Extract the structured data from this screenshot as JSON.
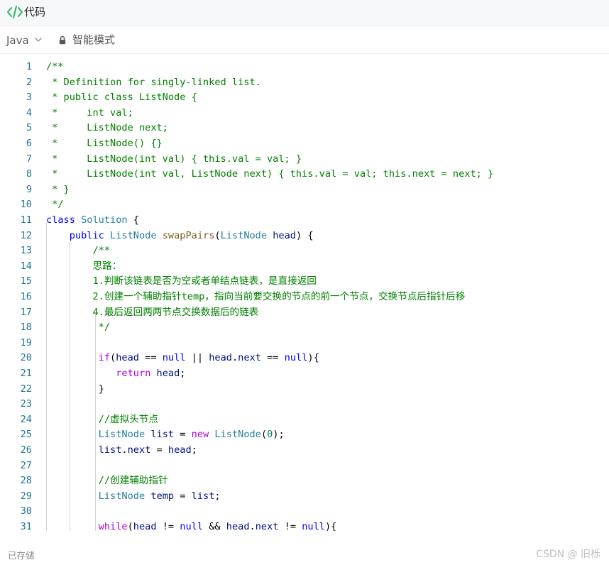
{
  "header": {
    "title": "代码",
    "icon": "code-icon",
    "accent": "#2db55d"
  },
  "toolbar": {
    "language": "Java",
    "mode": "智能模式"
  },
  "editor": {
    "lines": [
      {
        "n": "1",
        "s": [
          [
            "cm",
            "/**"
          ]
        ]
      },
      {
        "n": "2",
        "s": [
          [
            "cm",
            " * Definition for singly-linked list."
          ]
        ]
      },
      {
        "n": "3",
        "s": [
          [
            "cm",
            " * public class ListNode {"
          ]
        ]
      },
      {
        "n": "4",
        "s": [
          [
            "cm",
            " *     int val;"
          ]
        ]
      },
      {
        "n": "5",
        "s": [
          [
            "cm",
            " *     ListNode next;"
          ]
        ]
      },
      {
        "n": "6",
        "s": [
          [
            "cm",
            " *     ListNode() {}"
          ]
        ]
      },
      {
        "n": "7",
        "s": [
          [
            "cm",
            " *     ListNode(int val) { this.val = val; }"
          ]
        ]
      },
      {
        "n": "8",
        "s": [
          [
            "cm",
            " *     ListNode(int val, ListNode next) { this.val = val; this.next = next; }"
          ]
        ]
      },
      {
        "n": "9",
        "s": [
          [
            "cm",
            " * }"
          ]
        ]
      },
      {
        "n": "10",
        "s": [
          [
            "cm",
            " */"
          ]
        ]
      },
      {
        "n": "11",
        "s": [
          [
            "kw",
            "class"
          ],
          [
            "",
            " "
          ],
          [
            "ty",
            "Solution"
          ],
          [
            "",
            " {"
          ]
        ]
      },
      {
        "n": "12",
        "s": [
          [
            "",
            "    "
          ],
          [
            "kw",
            "public"
          ],
          [
            "",
            " "
          ],
          [
            "ty",
            "ListNode"
          ],
          [
            "",
            " "
          ],
          [
            "fn",
            "swapPairs"
          ],
          [
            "",
            "("
          ],
          [
            "ty",
            "ListNode"
          ],
          [
            "",
            " "
          ],
          [
            "va",
            "head"
          ],
          [
            "",
            ") {"
          ]
        ]
      },
      {
        "n": "13",
        "s": [
          [
            "cm",
            "        /**"
          ]
        ]
      },
      {
        "n": "14",
        "s": [
          [
            "cm",
            "        思路："
          ]
        ]
      },
      {
        "n": "15",
        "s": [
          [
            "cm",
            "        1.判断该链表是否为空或者单结点链表，是直接返回"
          ]
        ]
      },
      {
        "n": "16",
        "s": [
          [
            "cm",
            "        2.创建一个辅助指针temp，指向当前要交换的节点的前一个节点，交换节点后指针后移"
          ]
        ]
      },
      {
        "n": "17",
        "s": [
          [
            "cm",
            "        4.最后返回两两节点交换数据后的链表"
          ]
        ]
      },
      {
        "n": "18",
        "s": [
          [
            "cm",
            "         */"
          ]
        ]
      },
      {
        "n": "19",
        "s": []
      },
      {
        "n": "20",
        "s": [
          [
            "",
            "         "
          ],
          [
            "ctl",
            "if"
          ],
          [
            "",
            "("
          ],
          [
            "va",
            "head"
          ],
          [
            "",
            " == "
          ],
          [
            "kw",
            "null"
          ],
          [
            "",
            " || "
          ],
          [
            "va",
            "head"
          ],
          [
            "",
            "."
          ],
          [
            "va",
            "next"
          ],
          [
            "",
            " == "
          ],
          [
            "kw",
            "null"
          ],
          [
            "",
            "){"
          ]
        ]
      },
      {
        "n": "21",
        "s": [
          [
            "",
            "            "
          ],
          [
            "ctl",
            "return"
          ],
          [
            "",
            " "
          ],
          [
            "va",
            "head"
          ],
          [
            "",
            ";"
          ]
        ]
      },
      {
        "n": "22",
        "s": [
          [
            "",
            "         }"
          ]
        ]
      },
      {
        "n": "23",
        "s": []
      },
      {
        "n": "24",
        "s": [
          [
            "cm",
            "         //虚拟头节点"
          ]
        ]
      },
      {
        "n": "25",
        "s": [
          [
            "",
            "         "
          ],
          [
            "ty",
            "ListNode"
          ],
          [
            "",
            " "
          ],
          [
            "va",
            "list"
          ],
          [
            "",
            " = "
          ],
          [
            "ctl",
            "new"
          ],
          [
            "",
            " "
          ],
          [
            "ty",
            "ListNode"
          ],
          [
            "",
            "("
          ],
          [
            "nu",
            "0"
          ],
          [
            "",
            ");"
          ]
        ]
      },
      {
        "n": "26",
        "s": [
          [
            "",
            "         "
          ],
          [
            "va",
            "list"
          ],
          [
            "",
            "."
          ],
          [
            "va",
            "next"
          ],
          [
            "",
            " = "
          ],
          [
            "va",
            "head"
          ],
          [
            "",
            ";"
          ]
        ]
      },
      {
        "n": "27",
        "s": []
      },
      {
        "n": "28",
        "s": [
          [
            "cm",
            "         //创建辅助指针"
          ]
        ]
      },
      {
        "n": "29",
        "s": [
          [
            "",
            "         "
          ],
          [
            "ty",
            "ListNode"
          ],
          [
            "",
            " "
          ],
          [
            "va",
            "temp"
          ],
          [
            "",
            " = "
          ],
          [
            "va",
            "list"
          ],
          [
            "",
            ";"
          ]
        ]
      },
      {
        "n": "30",
        "s": []
      },
      {
        "n": "31",
        "s": [
          [
            "",
            "         "
          ],
          [
            "ctl",
            "while"
          ],
          [
            "",
            "("
          ],
          [
            "va",
            "head"
          ],
          [
            "",
            " != "
          ],
          [
            "kw",
            "null"
          ],
          [
            "",
            " && "
          ],
          [
            "va",
            "head"
          ],
          [
            "",
            "."
          ],
          [
            "va",
            "next"
          ],
          [
            "",
            " != "
          ],
          [
            "kw",
            "null"
          ],
          [
            "",
            "){"
          ]
        ]
      }
    ]
  },
  "footer": {
    "status": "已存储",
    "watermark": "CSDN @ 旧栎"
  }
}
